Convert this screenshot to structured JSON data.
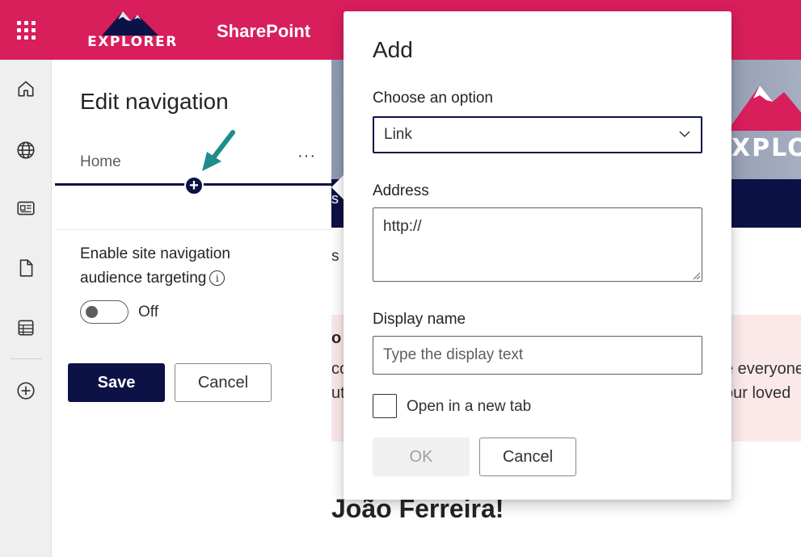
{
  "suite_bar": {
    "logo_text": "EXPLORER",
    "title": "SharePoint",
    "waffle_icon": "app-launcher-icon"
  },
  "rail": {
    "items": [
      "home-icon",
      "globe-icon",
      "news-icon",
      "document-icon",
      "list-icon",
      "add-icon"
    ]
  },
  "edit_nav": {
    "title": "Edit navigation",
    "items": [
      {
        "label": "Home"
      }
    ],
    "more_label": "···",
    "audience_label": "Enable site navigation audience targeting",
    "toggle_state": "Off",
    "save_label": "Save",
    "cancel_label": "Cancel"
  },
  "background_page": {
    "hero_logo_text": "XPLORER",
    "nav_fragment": "s",
    "text_fragment": "s",
    "banner_heading_fragment": "o",
    "banner_line1_left": "co",
    "banner_line2_left": "ut",
    "banner_line1_right": "e everyone",
    "banner_line2_right": "our loved",
    "welcome_fragment": "João Ferreira!"
  },
  "add_dialog": {
    "title": "Add",
    "option_label": "Choose an option",
    "option_value": "Link",
    "address_label": "Address",
    "address_value": "http://",
    "display_name_label": "Display name",
    "display_name_placeholder": "Type the display text",
    "new_tab_label": "Open in a new tab",
    "new_tab_checked": false,
    "ok_label": "OK",
    "cancel_label": "Cancel"
  },
  "colors": {
    "brand_pink": "#d81e5b",
    "navy": "#0c1245",
    "arrow_teal": "#1f8c8c"
  }
}
